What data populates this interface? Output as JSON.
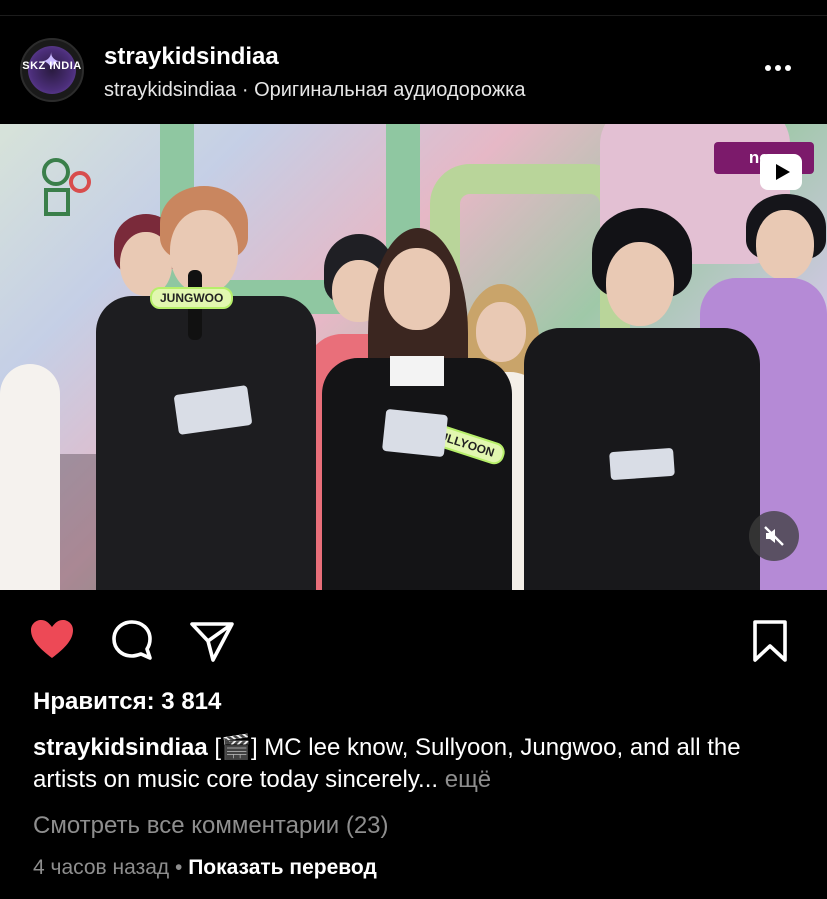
{
  "post": {
    "username": "straykidsindiaa",
    "audio_owner": "straykidsindiaa",
    "audio_separator": " · ",
    "audio_label": "Оригинальная аудиодорожка",
    "avatar_text": "SKZ INDIA"
  },
  "media": {
    "badge_text": "noc",
    "name_tag_left": "JUNGWOO",
    "name_tag_center": "SULLYOON",
    "muted": true
  },
  "actions": {
    "liked": true,
    "like_color": "#ed4956"
  },
  "likes": {
    "label": "Нравится: 3 814"
  },
  "caption": {
    "user": "straykidsindiaa",
    "text": " [🎬] MC lee know, Sullyoon, Jungwoo, and all the artists on music core today sincerely...",
    "more": " ещё"
  },
  "comments": {
    "label": "Смотреть все комментарии (23)"
  },
  "meta": {
    "time": "4 часов назад",
    "separator": " • ",
    "translate": "Показать перевод"
  }
}
